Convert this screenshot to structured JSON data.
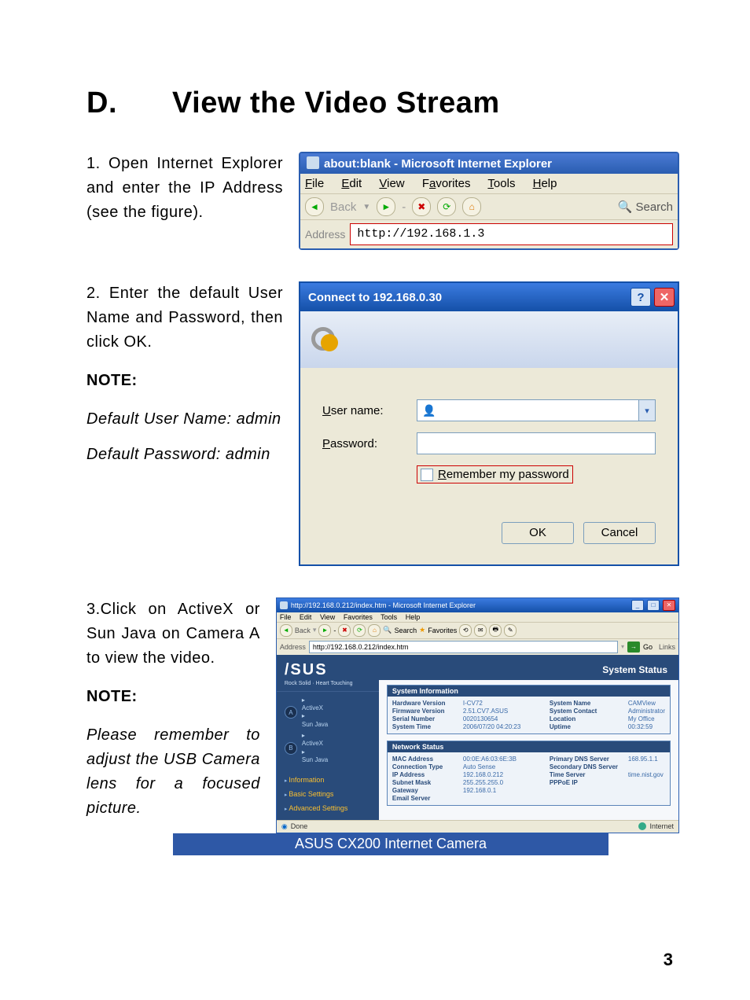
{
  "heading": {
    "letter": "D.",
    "title": "View the Video Stream"
  },
  "step1": {
    "text": "1. Open Internet Explorer and enter the IP Address (see the figure).",
    "ie": {
      "title": "about:blank - Microsoft Internet Explorer",
      "menu": {
        "file": "File",
        "edit": "Edit",
        "view": "View",
        "fav": "Favorites",
        "tools": "Tools",
        "help": "Help"
      },
      "back": "Back",
      "search": "Search",
      "addr_label": "Address",
      "addr_value": "http://192.168.1.3"
    }
  },
  "step2": {
    "text": "2. Enter the default User Name and Password, then click OK.",
    "note_head": "NOTE:",
    "note1": "Default User Name: admin",
    "note2": "Default Password: admin",
    "dlg": {
      "title": "Connect to 192.168.0.30",
      "user_label": "User name:",
      "pass_label": "Password:",
      "remember": "Remember my password",
      "ok": "OK",
      "cancel": "Cancel"
    }
  },
  "step3": {
    "text": "3.Click on ActiveX or Sun Java on Camera A to view the video.",
    "note_head": "NOTE:",
    "note": "Please remember to adjust the USB Camera lens for a focused picture.",
    "win": {
      "title": "http://192.168.0.212/index.htm - Microsoft Internet Explorer",
      "menu": {
        "file": "File",
        "edit": "Edit",
        "view": "View",
        "fav": "Favorites",
        "tools": "Tools",
        "help": "Help"
      },
      "toolbar": {
        "back": "Back",
        "search": "Search",
        "fav": "Favorites"
      },
      "addr_label": "Address",
      "addr_value": "http://192.168.0.212/index.htm",
      "go": "Go",
      "links": "Links",
      "done": "Done",
      "zone": "Internet"
    },
    "cam": {
      "brand": "/SUS",
      "tag": "Rock Solid · Heart Touching",
      "header": "System Status",
      "camA": "A",
      "camB": "B",
      "activex": "ActiveX",
      "sunjava": "Sun Java",
      "nav": {
        "info": "Information",
        "basic": "Basic Settings",
        "adv": "Advanced Settings"
      },
      "sysinfo": {
        "title": "System Information",
        "rows": [
          [
            "Hardware Version",
            "I-CV72",
            "System Name",
            "CAMView"
          ],
          [
            "Firmware Version",
            "2.51.CV7.ASUS",
            "System Contact",
            "Administrator"
          ],
          [
            "Serial Number",
            "0020130654",
            "Location",
            "My Office"
          ],
          [
            "System Time",
            "2006/07/20 04:20:23",
            "Uptime",
            "00:32:59"
          ]
        ]
      },
      "netstat": {
        "title": "Network Status",
        "rows": [
          [
            "MAC Address",
            "00:0E:A6:03:6E:3B",
            "Primary DNS Server",
            "168.95.1.1"
          ],
          [
            "Connection Type",
            "Auto Sense",
            "Secondary DNS Server",
            ""
          ],
          [
            "IP Address",
            "192.168.0.212",
            "Time Server",
            "time.nist.gov"
          ],
          [
            "Subnet Mask",
            "255.255.255.0",
            "PPPoE IP",
            ""
          ],
          [
            "Gateway",
            "192.168.0.1",
            "",
            ""
          ],
          [
            "Email Server",
            "",
            "",
            ""
          ]
        ]
      }
    }
  },
  "footer": {
    "text": "ASUS CX200 Internet Camera",
    "page": "3"
  }
}
